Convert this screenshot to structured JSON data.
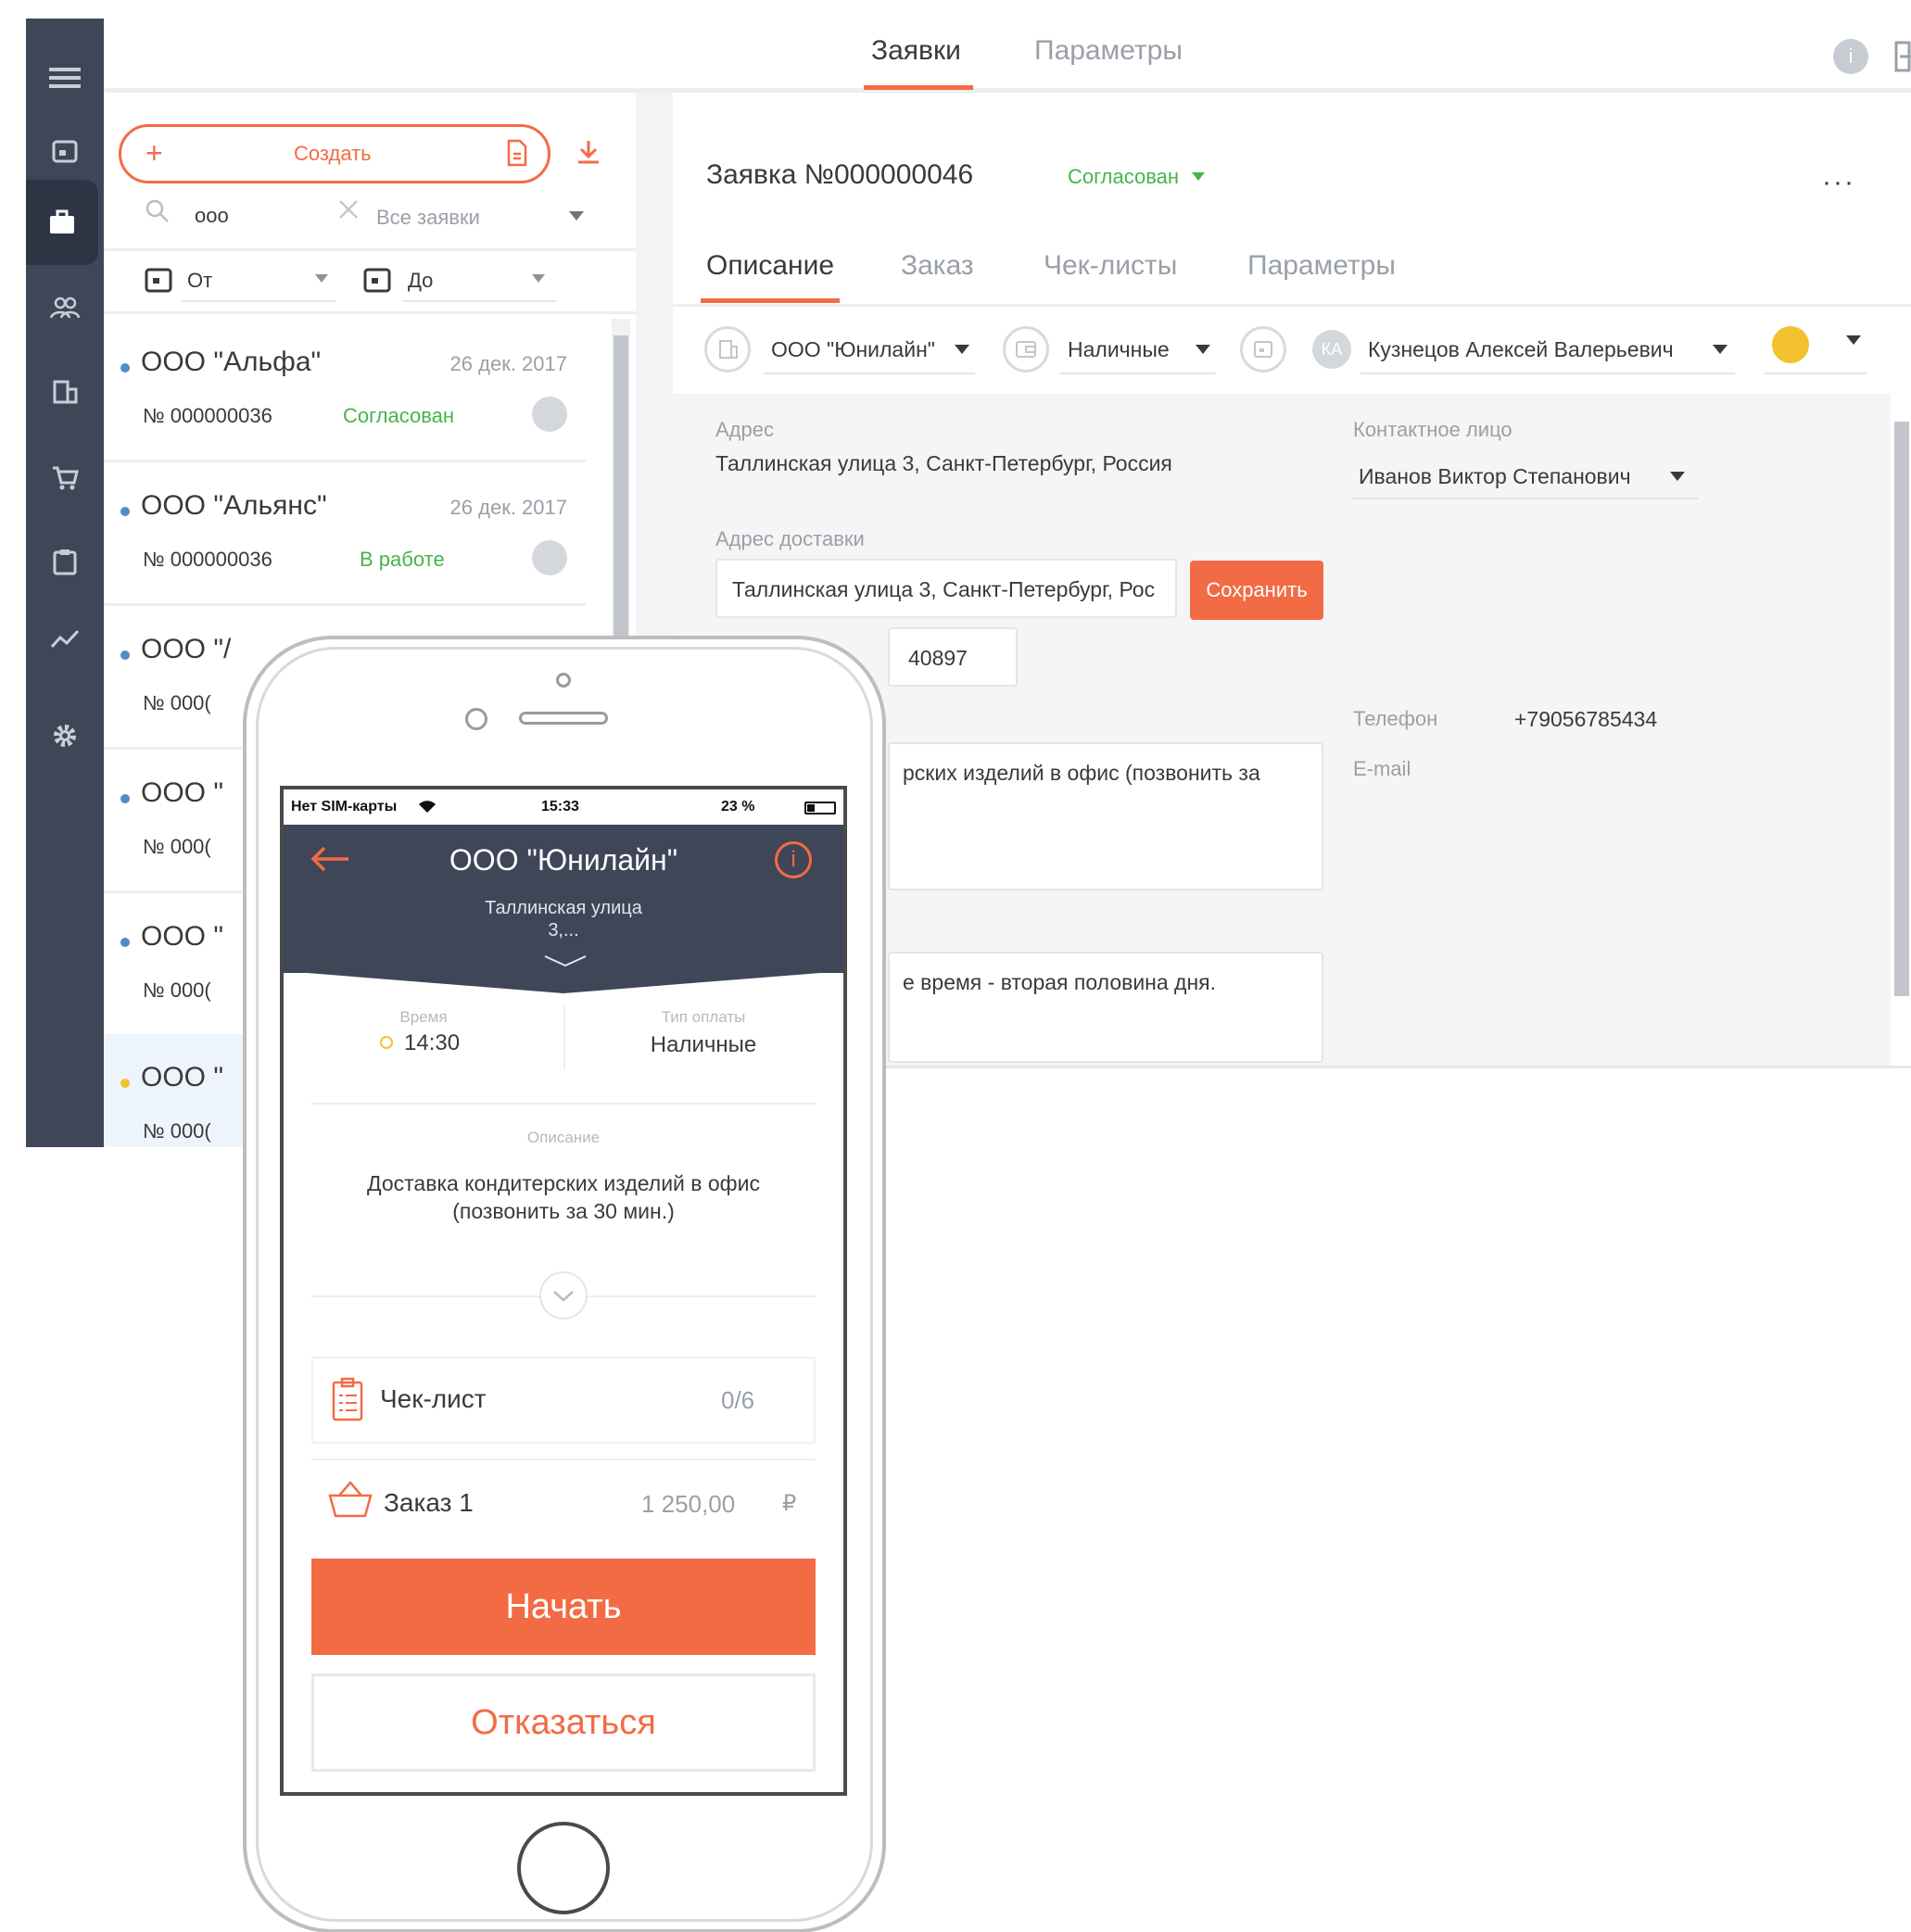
{
  "topbar": {
    "tabs": [
      {
        "label": "Заявки"
      },
      {
        "label": "Параметры"
      }
    ],
    "active_tab": 0
  },
  "list": {
    "create_label": "Создать",
    "search_value": "ооо",
    "filter_label": "Все заявки",
    "date_from": "От",
    "date_to": "До",
    "items": [
      {
        "name": "ООО \"Альфа\"",
        "date": "26 дек. 2017",
        "number": "№ 000000036",
        "status": "Согласован",
        "status_color": "#46b44a"
      },
      {
        "name": "ООО \"Альянс\"",
        "date": "26 дек. 2017",
        "number": "№ 000000036",
        "status": "В работе",
        "status_color": "#46b44a"
      },
      {
        "name": "ООО \"/",
        "number": "№ 000("
      },
      {
        "name": "ООО \"",
        "number": "№ 000("
      },
      {
        "name": "ООО \"",
        "number": "№ 000("
      },
      {
        "name": "ООО \"",
        "number": "№ 000("
      }
    ]
  },
  "detail": {
    "title": "Заявка №000000046",
    "status": "Согласован",
    "tabs": [
      {
        "label": "Описание"
      },
      {
        "label": "Заказ"
      },
      {
        "label": "Чек-листы"
      },
      {
        "label": "Параметры"
      }
    ],
    "company": "ООО \"Юнилайн\"",
    "payment": "Наличные",
    "assignee_initials": "КА",
    "assignee": "Кузнецов Алексей Валерьевич",
    "address_label": "Адрес",
    "address_value": "Таллинская улица 3, Санкт-Петербург, Россия",
    "contact_label": "Контактное лицо",
    "contact_value": "Иванов Виктор Степанович",
    "delivery_label": "Адрес доставки",
    "delivery_value": "Таллинская улица 3, Санкт-Петербург, Рос",
    "save_label": "Сохранить",
    "partial_number": "40897",
    "phone_label": "Телефон",
    "phone_value": "+79056785434",
    "email_label": "E-mail",
    "desc_partial": "рских изделий в офис (позвонить за",
    "comment_partial": "е время - вторая половина дня."
  },
  "phone": {
    "status_carrier": "Нет SIM-карты",
    "status_time": "15:33",
    "status_battery": "23 %",
    "title": "ООО \"Юнилайн\"",
    "subtitle": "Таллинская улица 3,...",
    "time_label": "Время",
    "time_value": "14:30",
    "pay_label": "Тип оплаты",
    "pay_value": "Наличные",
    "desc_label": "Описание",
    "desc_value": "Доставка кондитерских изделий в офис (позвонить за 30 мин.)",
    "checklist_label": "Чек-лист",
    "checklist_value": "0/6",
    "order_label": "Заказ 1",
    "order_value": "1 250,00",
    "currency": "₽",
    "start_label": "Начать",
    "cancel_label": "Отказаться"
  },
  "colors": {
    "accent": "#f36b45",
    "sidebar": "#3f4658",
    "green": "#46b44a",
    "yellow": "#f2c12e"
  }
}
